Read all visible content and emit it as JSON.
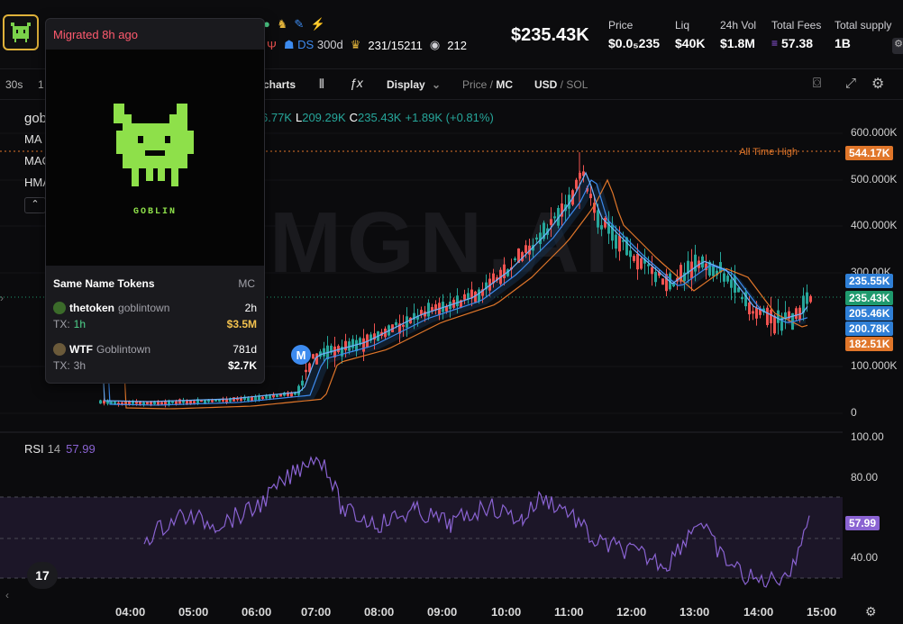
{
  "header": {
    "market_cap": "$235.43K",
    "stats": [
      {
        "label": "Price",
        "value": "$0.0₅235"
      },
      {
        "label": "Liq",
        "value": "$40K"
      },
      {
        "label": "24h Vol",
        "value": "$1.8M"
      },
      {
        "label": "Total Fees",
        "value": "57.38"
      },
      {
        "label": "Total supply",
        "value": "1B"
      }
    ],
    "badges": {
      "ds": "DS",
      "age": "300d",
      "holders": "231/15211",
      "views": "212"
    }
  },
  "toolbar": {
    "timeframes": [
      "30s",
      "1"
    ],
    "charts_label": "charts",
    "display_label": "Display",
    "price_label": "Price",
    "mc_label": "MC",
    "usd_label": "USD",
    "sol_label": "SOL"
  },
  "legend": {
    "ohlc": "6.77K",
    "low_key": "L",
    "low": "209.29K",
    "close_key": "C",
    "close": "235.43K",
    "change": "+1.89K (+0.81%)",
    "symbol": "gob",
    "indicators": [
      "MA",
      "MAC",
      "HMA"
    ]
  },
  "chart": {
    "watermark": "GMGN.AI",
    "ath_label": "All Time High",
    "ath_value": "544.17K",
    "y_ticks": [
      "600.000K",
      "500.000K",
      "400.000K",
      "300.00K",
      "100.000K",
      "0"
    ],
    "price_tags": [
      {
        "value": "235.55K",
        "color": "#2f7fd6"
      },
      {
        "value": "235.43K",
        "color": "#1f9a6e"
      },
      {
        "value": "205.46K",
        "color": "#2f7fd6"
      },
      {
        "value": "200.78K",
        "color": "#2f7fd6"
      },
      {
        "value": "182.51K",
        "color": "#e0762a"
      }
    ],
    "migration_marker": "M",
    "rsi_label": "RSI",
    "rsi_period": "14",
    "rsi_value": "57.99",
    "rsi_ticks": [
      "100.00",
      "80.00",
      "40.00"
    ],
    "x_ticks": [
      "04:00",
      "05:00",
      "06:00",
      "07:00",
      "08:00",
      "09:00",
      "10:00",
      "11:00",
      "12:00",
      "13:00",
      "14:00",
      "15:00"
    ]
  },
  "popup": {
    "title": "Migrated 8h ago",
    "token_art_text": "GOBLIN",
    "section_title": "Same Name Tokens",
    "section_right": "MC",
    "tokens": [
      {
        "name": "thetoken",
        "handle": "goblintown",
        "age": "2h",
        "tx_label": "TX:",
        "tx": "1h",
        "mc": "$3.5M",
        "tx_color": "#4fd18b",
        "mc_color": "#f2c14e"
      },
      {
        "name": "WTF",
        "handle": "Goblintown",
        "age": "781d",
        "tx_label": "TX:",
        "tx": "3h",
        "mc": "$2.7K",
        "tx_color": "#a0a0a8",
        "mc_color": "#ffffff"
      }
    ]
  },
  "colors": {
    "up": "#26a69a",
    "down": "#ef5350",
    "accent": "#e0b23a",
    "rsi": "#8a63d2"
  }
}
